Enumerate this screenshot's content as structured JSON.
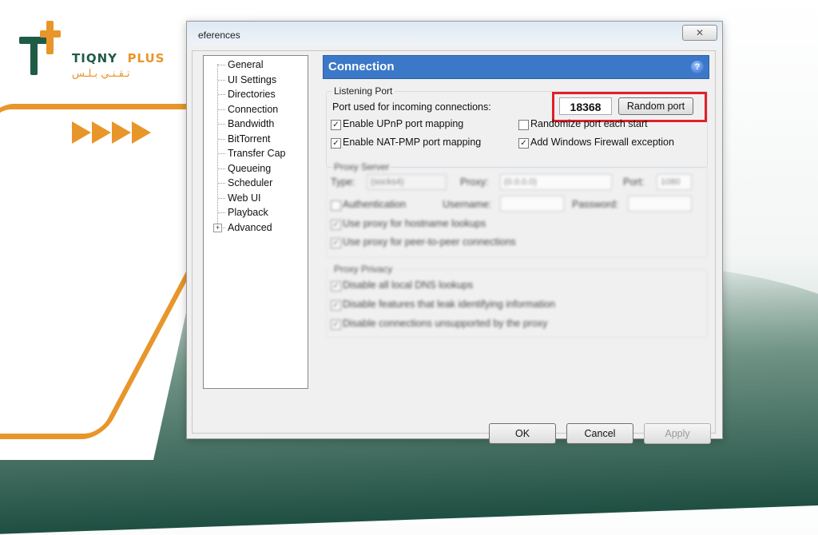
{
  "brand": {
    "name_part1": "TIQNY",
    "name_part2": "PLUS",
    "arabic": "تـقـنـي بـلـس"
  },
  "window": {
    "title": "eferences",
    "close_glyph": "✕"
  },
  "tree": {
    "items": [
      {
        "label": "General"
      },
      {
        "label": "UI Settings"
      },
      {
        "label": "Directories"
      },
      {
        "label": "Connection"
      },
      {
        "label": "Bandwidth"
      },
      {
        "label": "BitTorrent"
      },
      {
        "label": "Transfer Cap"
      },
      {
        "label": "Queueing"
      },
      {
        "label": "Scheduler"
      },
      {
        "label": "Web UI"
      },
      {
        "label": "Playback"
      },
      {
        "label": "Advanced"
      }
    ],
    "expander": "+"
  },
  "panel": {
    "title": "Connection",
    "help_glyph": "?",
    "listening_port": {
      "legend": "Listening Port",
      "port_label": "Port used for incoming connections:",
      "port_value": "18368",
      "random_port_button": "Random port",
      "enable_upnp": {
        "label": "Enable UPnP port mapping",
        "checked": true
      },
      "enable_natpmp": {
        "label": "Enable NAT-PMP port mapping",
        "checked": true
      },
      "randomize_port": {
        "label": "Randomize port each start",
        "checked": false
      },
      "firewall": {
        "label": "Add Windows Firewall exception",
        "checked": true
      }
    },
    "proxy_server": {
      "legend": "Proxy Server",
      "type_label": "Type:",
      "type_value": "(socks4)",
      "proxy_label": "Proxy:",
      "proxy_value": "(0.0.0.0)",
      "port_label": "Port:",
      "port_value": "1080",
      "authentication": "Authentication",
      "username_label": "Username:",
      "password_label": "Password:",
      "hostname_lookups": "Use proxy for hostname lookups",
      "p2p_connections": "Use proxy for peer-to-peer connections"
    },
    "proxy_privacy": {
      "legend": "Proxy Privacy",
      "dns": "Disable all local DNS lookups",
      "features": "Disable features that leak identifying information",
      "unsupported": "Disable connections unsupported by the proxy"
    }
  },
  "footer": {
    "ok": "OK",
    "cancel": "Cancel",
    "apply": "Apply"
  },
  "colors": {
    "accent_orange": "#e8962a",
    "brand_green": "#1f5c45",
    "panel_header_blue": "#3c78c8",
    "highlight_red": "#e0202a"
  },
  "icons": [
    "tiqny-plus-logo",
    "arrow-right-icon",
    "close-icon",
    "help-icon",
    "expand-plus-icon",
    "checkbox-icon"
  ]
}
